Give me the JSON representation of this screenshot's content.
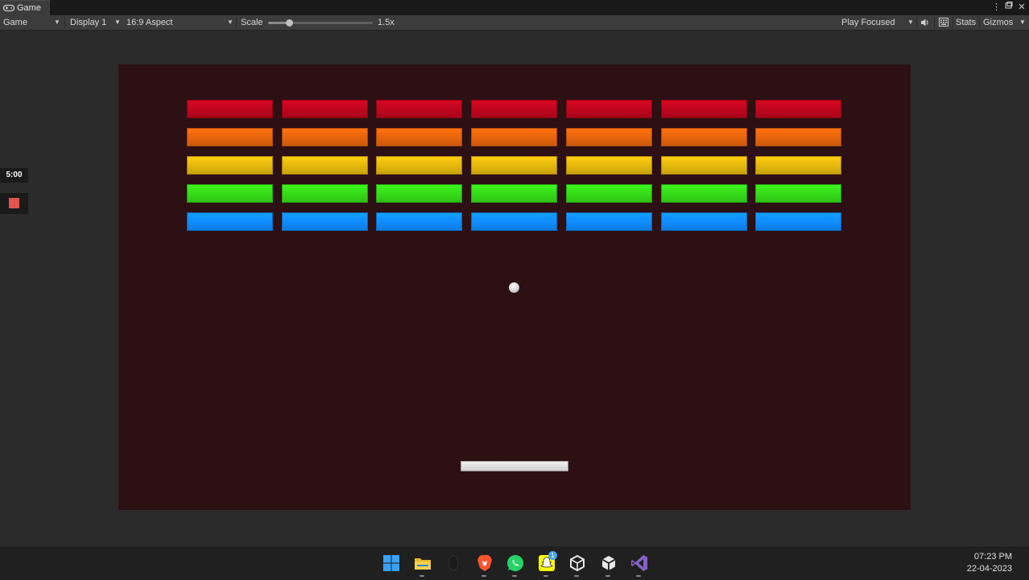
{
  "tab": {
    "title": "Game"
  },
  "toolbar": {
    "view_select": "Game",
    "display_select": "Display 1",
    "aspect_select": "16:9 Aspect",
    "scale_label": "Scale",
    "scale_value": "1.5x",
    "scale_slider_fraction": 0.2,
    "play_mode_select": "Play Focused",
    "stats_label": "Stats",
    "gizmos_label": "Gizmos"
  },
  "overlay": {
    "timer": "5:00",
    "record_color": "#e0554d"
  },
  "game": {
    "background_color": "#2c1013",
    "brick_columns": 7,
    "brick_rows": [
      {
        "color": "#c0061d",
        "name": "red"
      },
      {
        "color": "#e8650c",
        "name": "orange"
      },
      {
        "color": "#e4b80d",
        "name": "yellow"
      },
      {
        "color": "#35dc18",
        "name": "green"
      },
      {
        "color": "#108dff",
        "name": "blue"
      }
    ],
    "ball_color": "#e6e6e6",
    "paddle_color": "#e2e2e2"
  },
  "taskbar": {
    "icons": [
      "windows-start-icon",
      "file-explorer-icon",
      "app-icon",
      "brave-browser-icon",
      "whatsapp-icon",
      "snapchat-icon",
      "unity-hub-icon",
      "unity-editor-icon",
      "visual-studio-icon"
    ],
    "snapchat_badge": "1",
    "time": "07:23 PM",
    "date": "22-04-2023"
  }
}
